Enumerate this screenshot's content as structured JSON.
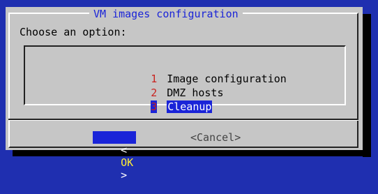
{
  "dialog": {
    "title": "VM images configuration",
    "prompt": "Choose an option:"
  },
  "menu": {
    "items": [
      {
        "tag": "1",
        "label": "Image configuration",
        "selected": false
      },
      {
        "tag": "2",
        "label": "DMZ hosts",
        "selected": false
      },
      {
        "tag": "3",
        "label": "Cleanup",
        "selected": true
      }
    ]
  },
  "buttons": {
    "ok_left": "<",
    "ok_label": "OK",
    "ok_right": ">",
    "cancel_label": "<Cancel>"
  },
  "colors": {
    "background": "#1f2fb0",
    "dialog": "#c6c6c6",
    "highlight": "#1a24d8",
    "tag": "#c8231f"
  }
}
